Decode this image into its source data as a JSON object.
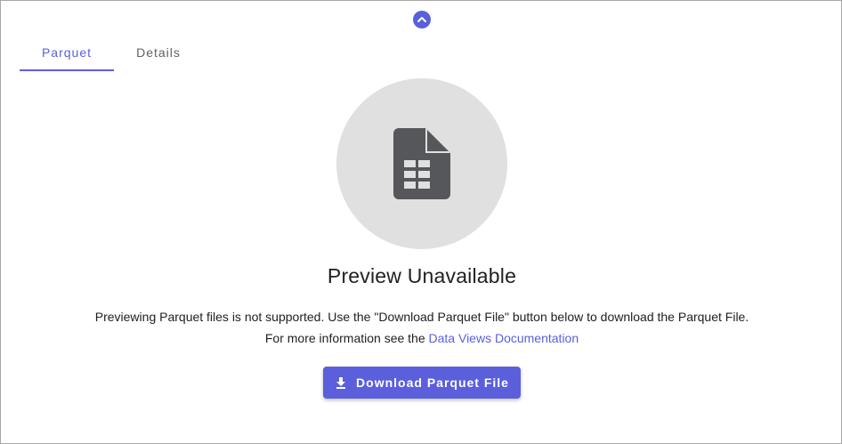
{
  "toggle": {
    "icon": "chevron-up-icon"
  },
  "tabs": [
    {
      "label": "Parquet",
      "active": true
    },
    {
      "label": "Details",
      "active": false
    }
  ],
  "preview": {
    "icon": "spreadsheet-file-icon",
    "title": "Preview Unavailable",
    "message_pre": "Previewing Parquet files is not supported. Use the \"Download Parquet File\" button below to download the Parquet File. For more information see the ",
    "link_text": "Data Views Documentation"
  },
  "download_button": {
    "label": "Download Parquet File",
    "icon": "download-icon"
  },
  "colors": {
    "accent": "#5b5fdb",
    "circle_bg": "#e0e0e0",
    "icon_gray": "#55575b",
    "text": "#212121",
    "inactive_tab": "#616161"
  }
}
